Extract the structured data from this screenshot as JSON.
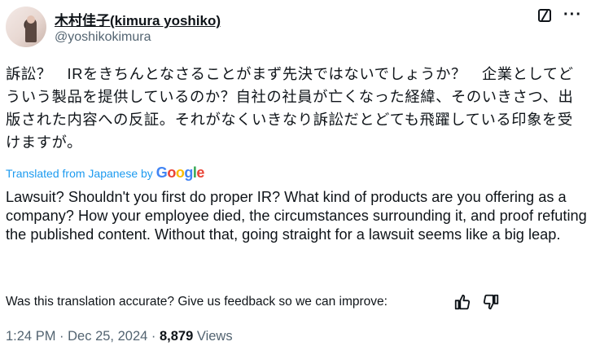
{
  "author": {
    "display_name": "木村佳子(kimura yoshiko)",
    "handle": "@yoshikokimura"
  },
  "post": {
    "text_ja": "訴訟？　IRをきちんとなさることがまず先決ではないでしょうか？　企業としてどういう製品を提供しているのか？自社の社員が亡くなった経緯、そのいきさつ、出版された内容への反証。それがなくいきなり訴訟だとどても飛躍している印象を受けますが。",
    "translated_label": "Translated from Japanese by",
    "translator_logo": [
      "G",
      "o",
      "o",
      "g",
      "l",
      "e"
    ],
    "text_en": "Lawsuit? Shouldn't you first do proper IR? What kind of products are you offering as a company? How your employee died, the circumstances surrounding it, and proof refuting the published content. Without that, going straight for a lawsuit seems like a big leap.",
    "feedback_prompt": "Was this translation accurate? Give us feedback so we can improve:"
  },
  "meta": {
    "time": "1:24 PM",
    "separator": "·",
    "date": "Dec 25, 2024",
    "views_count": "8,879",
    "views_label": "Views"
  },
  "icons": {
    "edit": "grok-edit-icon",
    "more": "more-horizontal-icon",
    "thumbs_up": "thumbs-up-icon",
    "thumbs_down": "thumbs-down-icon"
  },
  "colors": {
    "link_blue": "#1d9bf0",
    "secondary_text": "#536471",
    "primary_text": "#0f1419"
  }
}
